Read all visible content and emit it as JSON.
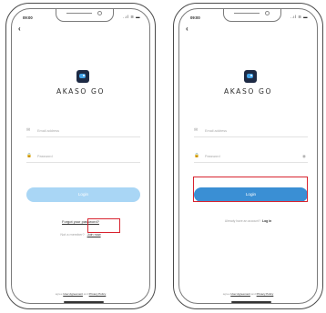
{
  "colors": {
    "brand_dark": "#1d2a44",
    "brand_light": "#43a3e8",
    "button_disabled": "#a9d6f5",
    "button_enabled": "#3a8fd4",
    "highlight": "#d8232f"
  },
  "left_screen": {
    "status_time": "09:00",
    "status_icons": "..ıl ≋ ▬",
    "brand": "AKASO GO",
    "email_placeholder": "Email address",
    "password_placeholder": "Password",
    "login_label": "Login",
    "login_state": "disabled",
    "forgot_label": "Forgot your password?",
    "member_prompt": "Not a member?",
    "join_label": "Join now",
    "agree_prefix": "agree",
    "user_agreement": "User Agreement",
    "and_text": "and",
    "privacy_policy": "Privacy Policy"
  },
  "right_screen": {
    "status_time": "09:00",
    "status_icons": "..ıl ≋ ▬",
    "brand": "AKASO GO",
    "email_placeholder": "Email address",
    "password_placeholder": "Password",
    "login_label": "Login",
    "login_state": "enabled",
    "account_prompt": "Already have an account?",
    "login_link": "Log in",
    "agree_prefix": "agree",
    "user_agreement": "User Agreement",
    "and_text": "and",
    "privacy_policy": "Privacy Policy"
  },
  "icons": {
    "back": "back-arrow-icon",
    "email": "mail-icon",
    "password": "lock-icon",
    "show_password": "eye-icon",
    "app_logo": "akaso-camera-logo-icon"
  }
}
